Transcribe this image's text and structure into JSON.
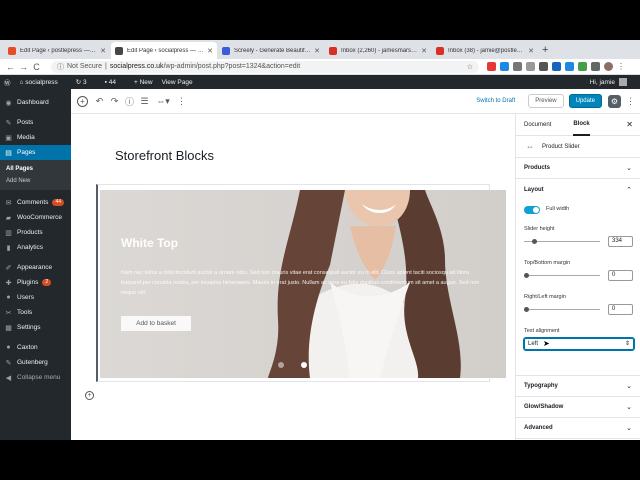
{
  "browser": {
    "tabs": [
      {
        "title": "Edit Page ‹ postlepress — Wo",
        "favicon_color": "#e44d26",
        "active": false
      },
      {
        "title": "Edit Page ‹ socialpress — Wo",
        "favicon_color": "#464646",
        "active": true
      },
      {
        "title": "Screely - Generate Beautiful M",
        "favicon_color": "#3b5bdb",
        "active": false
      },
      {
        "title": "Inbox (2,260) - jamesmarsland",
        "favicon_color": "#d93025",
        "active": false
      },
      {
        "title": "Inbox (38) - jamie@postlepres",
        "favicon_color": "#d93025",
        "active": false
      }
    ],
    "new_tab": "+",
    "back": "←",
    "forward": "→",
    "reload": "C",
    "not_secure": "Not Secure",
    "url_domain": "socialpress.co.uk",
    "url_path": "/wp-admin/post.php?post=1324&action=edit"
  },
  "adminbar": {
    "site": "socialpress",
    "updates": "3",
    "comments": "44",
    "new": "+ New",
    "view": "View Page",
    "greeting": "Hi, jamie"
  },
  "sidebar": {
    "items": [
      {
        "label": "Dashboard",
        "icon": "dashboard-icon",
        "glyph": "◉"
      },
      {
        "label": "Posts",
        "icon": "pin-icon",
        "glyph": "✎"
      },
      {
        "label": "Media",
        "icon": "media-icon",
        "glyph": "▣"
      },
      {
        "label": "Pages",
        "icon": "page-icon",
        "glyph": "▤"
      }
    ],
    "sub": [
      "All Pages",
      "Add New"
    ],
    "items2": [
      {
        "label": "Comments",
        "icon": "comment-icon",
        "glyph": "✉",
        "badge": "44"
      },
      {
        "label": "WooCommerce",
        "icon": "woo-icon",
        "glyph": "▰"
      },
      {
        "label": "Products",
        "icon": "product-icon",
        "glyph": "▥"
      },
      {
        "label": "Analytics",
        "icon": "chart-icon",
        "glyph": "▮"
      },
      {
        "label": "Appearance",
        "icon": "brush-icon",
        "glyph": "✐"
      },
      {
        "label": "Plugins",
        "icon": "plugin-icon",
        "glyph": "✚",
        "badge": "2"
      },
      {
        "label": "Users",
        "icon": "user-icon",
        "glyph": "●"
      },
      {
        "label": "Tools",
        "icon": "wrench-icon",
        "glyph": "✂"
      },
      {
        "label": "Settings",
        "icon": "settings-icon",
        "glyph": "▦"
      },
      {
        "label": "Caxton",
        "icon": "caxton-icon",
        "glyph": "●"
      },
      {
        "label": "Gutenberg",
        "icon": "gutenberg-icon",
        "glyph": "✎"
      },
      {
        "label": "Collapse menu",
        "icon": "collapse-icon",
        "glyph": "◀"
      }
    ]
  },
  "toolbar": {
    "switch_draft": "Switch to Draft",
    "preview": "Preview",
    "update": "Update"
  },
  "editor": {
    "page_title": "Storefront Blocks",
    "hero_title": "White Top",
    "hero_text": "Nam nec tellus a odio tincidunt auctor a ornare odio. Sed non mauris vitae erat consequat auctor eu in elit. Class aptent taciti sociosqu ad litora torquent per conubia nostra, per inceptos himenaeos. Mauris in erat justo. Nullam ac urna eu felis dapibus condimentum sit amet a augue. Sed non neque elit.",
    "hero_button": "Add to basket"
  },
  "panel": {
    "tab_document": "Document",
    "tab_block": "Block",
    "block_name": "Product Slider",
    "sections": {
      "products": "Products",
      "layout": "Layout",
      "typography": "Typography",
      "glow": "Glow/Shadow",
      "advanced": "Advanced"
    },
    "full_width": "Full width",
    "slider_height_label": "Slider height",
    "slider_height": "334",
    "tb_margin_label": "Top/Bottom margin",
    "tb_margin": "0",
    "rl_margin_label": "Right/Left margin",
    "rl_margin": "0",
    "text_alignment_label": "Text alignment",
    "text_alignment": "Left"
  }
}
